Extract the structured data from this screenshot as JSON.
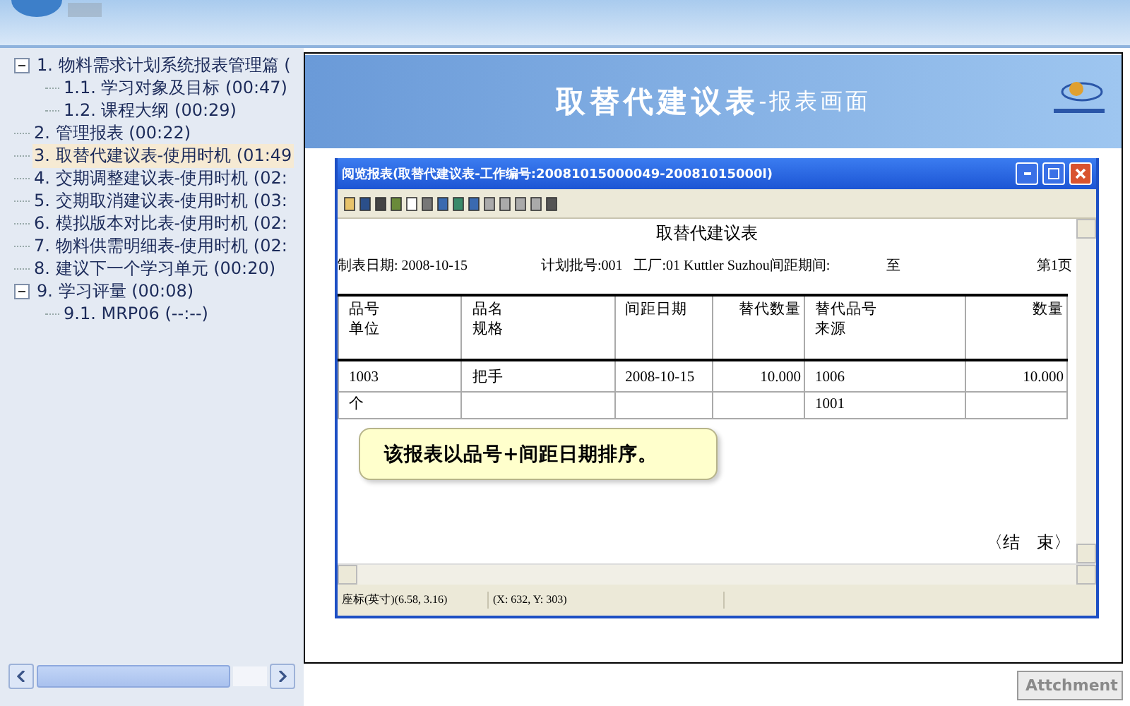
{
  "tree": [
    {
      "label": "1. 物料需求计划系统报表管理篇 (",
      "selected": false,
      "expanded": true,
      "children": [
        {
          "label": "1.1. 学习对象及目标 (00:47)",
          "selected": false
        },
        {
          "label": "1.2. 课程大纲 (00:29)",
          "selected": false
        }
      ]
    },
    {
      "label": "2. 管理报表 (00:22)",
      "selected": false
    },
    {
      "label": "3. 取替代建议表-使用时机 (01:49",
      "selected": true
    },
    {
      "label": "4. 交期调整建议表-使用时机 (02:",
      "selected": false
    },
    {
      "label": "5. 交期取消建议表-使用时机 (03:",
      "selected": false
    },
    {
      "label": "6. 模拟版本对比表-使用时机 (02:",
      "selected": false
    },
    {
      "label": "7. 物料供需明细表-使用时机 (02:",
      "selected": false
    },
    {
      "label": "8. 建议下一个学习单元 (00:20)",
      "selected": false
    },
    {
      "label": "9. 学习评量 (00:08)",
      "selected": false,
      "expanded": true,
      "children": [
        {
          "label": "9.1. MRP06 (--:--)",
          "selected": false
        }
      ]
    }
  ],
  "slide": {
    "title": "取替代建议表",
    "subtitle": "-报表画面",
    "report_window": {
      "title": "阅览报表(取替代建议表-工作编号:20081015000049-20081015000l)",
      "report_title": "取替代建议表",
      "meta": [
        "制表日期: 2008-10-15",
        "计划批号:001",
        "工厂:01 Kuttler Suzhou间距期间:",
        "至",
        "第1页"
      ],
      "columns": [
        {
          "lines": [
            "品号",
            "单位"
          ],
          "numeric": false
        },
        {
          "lines": [
            "品名",
            "规格"
          ],
          "numeric": false
        },
        {
          "lines": [
            "间距日期"
          ],
          "numeric": false
        },
        {
          "lines": [
            "替代数量"
          ],
          "numeric": true
        },
        {
          "lines": [
            "替代品号",
            "来源"
          ],
          "numeric": false
        },
        {
          "lines": [
            "数量"
          ],
          "numeric": true
        }
      ],
      "rows": [
        {
          "cells": [
            [
              "1003",
              "个"
            ],
            [
              "把手"
            ],
            [
              "2008-10-15"
            ],
            [
              "10.000"
            ],
            [
              "1006",
              "1001"
            ],
            [
              "10.000"
            ]
          ]
        }
      ],
      "end_mark": "〈结　束〉",
      "status": [
        "座标(英寸)(6.58, 3.16)",
        "(X: 632, Y: 303)"
      ]
    },
    "callout": "该报表以品号+间距日期排序。"
  },
  "attachment": {
    "label": "Attchment",
    "disabled": true
  }
}
